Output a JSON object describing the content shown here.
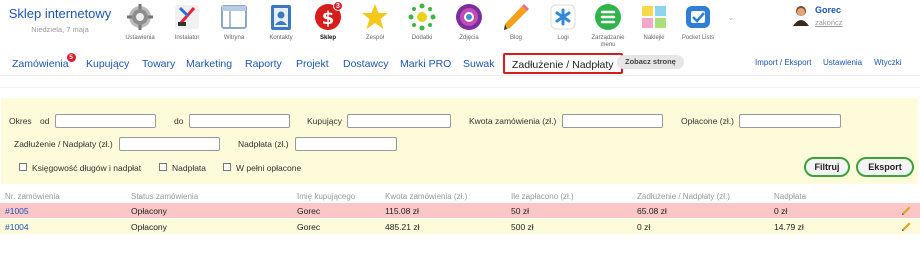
{
  "shop": {
    "name": "Sklep internetowy",
    "date": "Niedziela, 7 maja"
  },
  "apps": [
    {
      "label": "Ustawienia",
      "icon": "settings-icon"
    },
    {
      "label": "Instalator",
      "icon": "installer-icon"
    },
    {
      "label": "Witryna",
      "icon": "website-icon"
    },
    {
      "label": "Kontakty",
      "icon": "contacts-icon"
    },
    {
      "label": "Sklep",
      "icon": "shop-icon",
      "badge": "3",
      "active": true
    },
    {
      "label": "Zespół",
      "icon": "team-icon"
    },
    {
      "label": "Dodatki",
      "icon": "addons-icon"
    },
    {
      "label": "Zdjęcia",
      "icon": "photos-icon"
    },
    {
      "label": "Blog",
      "icon": "blog-icon"
    },
    {
      "label": "Logi",
      "icon": "logs-icon"
    },
    {
      "label": "Zarządzanie menu",
      "icon": "menu-management-icon"
    },
    {
      "label": "Naklejki",
      "icon": "stickers-icon"
    },
    {
      "label": "Pocket Lists",
      "icon": "pocket-lists-icon"
    }
  ],
  "more": "⌄",
  "user": {
    "name": "Gorec",
    "logout": "zakończ"
  },
  "nav": {
    "items": [
      {
        "label": "Zamówienia",
        "badge": "5"
      },
      {
        "label": "Kupujący"
      },
      {
        "label": "Towary"
      },
      {
        "label": "Marketing"
      },
      {
        "label": "Raporty"
      },
      {
        "label": "Projekt"
      },
      {
        "label": "Dostawcy"
      },
      {
        "label": "Marki PRO"
      },
      {
        "label": "Suwak"
      },
      {
        "label": "Zadłużenie / Nadpłaty",
        "active": true
      }
    ],
    "view_shop": "Zobacz stronę",
    "right_links": [
      "Import / Eksport",
      "Ustawienia",
      "Wtyczki"
    ]
  },
  "filters": {
    "period_label": "Okres",
    "from_label": "od",
    "to_label": "do",
    "buyer_label": "Kupujący",
    "order_amount_label": "Kwota zamówienia (zł.)",
    "paid_label": "Opłacone (zł.)",
    "debt_label": "Zadłużenie / Nadpłaty (zł.)",
    "overpayment_label": "Nadpłata (zł.)",
    "checkboxes": [
      "Księgowość długów i nadpłat",
      "Nadpłata",
      "W pełni opłacone"
    ],
    "filter_button": "Filtruj",
    "export_button": "Eksport"
  },
  "table": {
    "columns": [
      "Nr. zamówienia",
      "Status zamówienia",
      "Imię kupującego",
      "Kwota zamówienia (zł.)",
      "Ile zapłacono (zł.)",
      "Zadłużenie / Nadpłaty (zł.)",
      "Nadpłata"
    ],
    "rows": [
      {
        "order": "#1005",
        "status": "Opłacony",
        "buyer": "Gorec",
        "amount": "115.08 zł",
        "paid": "50 zł",
        "debt": "65.08 zł",
        "overpayment": "0 zł",
        "color": "#fbc6c6"
      },
      {
        "order": "#1004",
        "status": "Opłacony",
        "buyer": "Gorec",
        "amount": "485.21 zł",
        "paid": "500 zł",
        "debt": "0 zł",
        "overpayment": "14.79 zł",
        "color": "#fdfbd9"
      }
    ]
  },
  "colors": {
    "link": "#1a55b8",
    "active_tab_border": "#d81c1c",
    "button_border": "#3aa43a",
    "filter_bg": "#fdfbd9",
    "debt_row": "#fbc6c6"
  }
}
